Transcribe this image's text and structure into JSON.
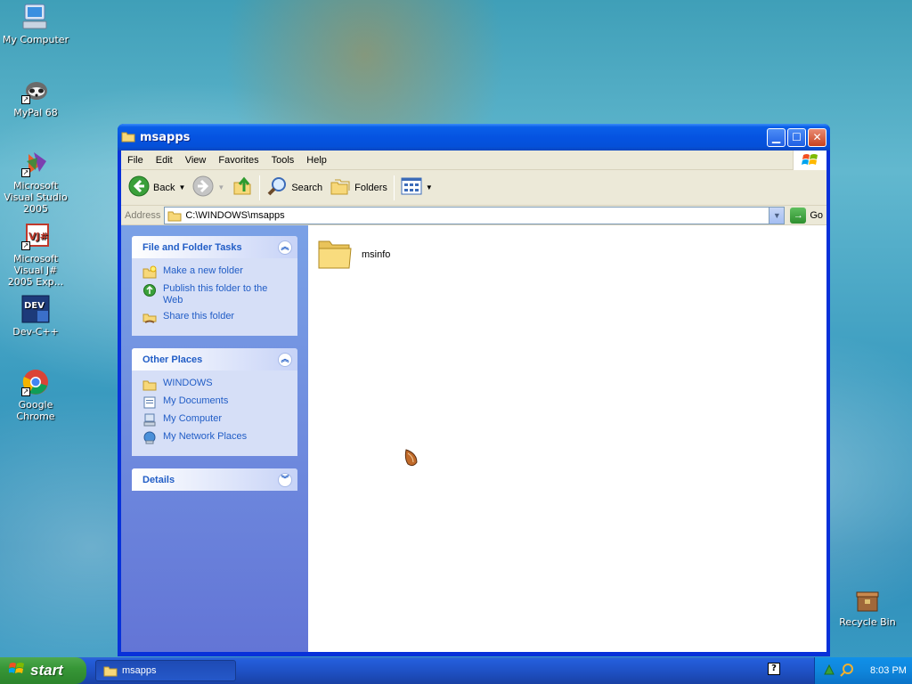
{
  "desktop": {
    "icons": [
      {
        "label": "My Computer",
        "icon": "my-computer-icon"
      },
      {
        "label": "MyPal 68",
        "icon": "raccoon-icon"
      },
      {
        "label": "Microsoft Visual Studio 2005",
        "icon": "visual-studio-icon"
      },
      {
        "label": "Microsoft Visual J# 2005 Exp...",
        "icon": "visual-jsharp-icon"
      },
      {
        "label": "Dev-C++",
        "icon": "dev-cpp-icon"
      },
      {
        "label": "Google Chrome",
        "icon": "chrome-icon"
      },
      {
        "label": "Recycle Bin",
        "icon": "recycle-bin-icon"
      }
    ]
  },
  "window": {
    "title": "msapps",
    "menu": [
      "File",
      "Edit",
      "View",
      "Favorites",
      "Tools",
      "Help"
    ],
    "toolbar": {
      "back": "Back",
      "search": "Search",
      "folders": "Folders"
    },
    "address": {
      "label": "Address",
      "path": "C:\\WINDOWS\\msapps",
      "go": "Go"
    },
    "tasks": {
      "file_folder": {
        "title": "File and Folder Tasks",
        "items": [
          "Make a new folder",
          "Publish this folder to the Web",
          "Share this folder"
        ]
      },
      "other_places": {
        "title": "Other Places",
        "items": [
          "WINDOWS",
          "My Documents",
          "My Computer",
          "My Network Places"
        ]
      },
      "details": {
        "title": "Details"
      }
    },
    "files": [
      {
        "name": "msinfo",
        "type": "folder"
      }
    ]
  },
  "taskbar": {
    "start": "start",
    "task_button": "msapps",
    "clock": "8:03 PM"
  },
  "colors": {
    "title_blue": "#0553e1",
    "link_blue": "#215dc6",
    "taskpane_top": "#7aa1e6",
    "start_green": "#379737"
  }
}
